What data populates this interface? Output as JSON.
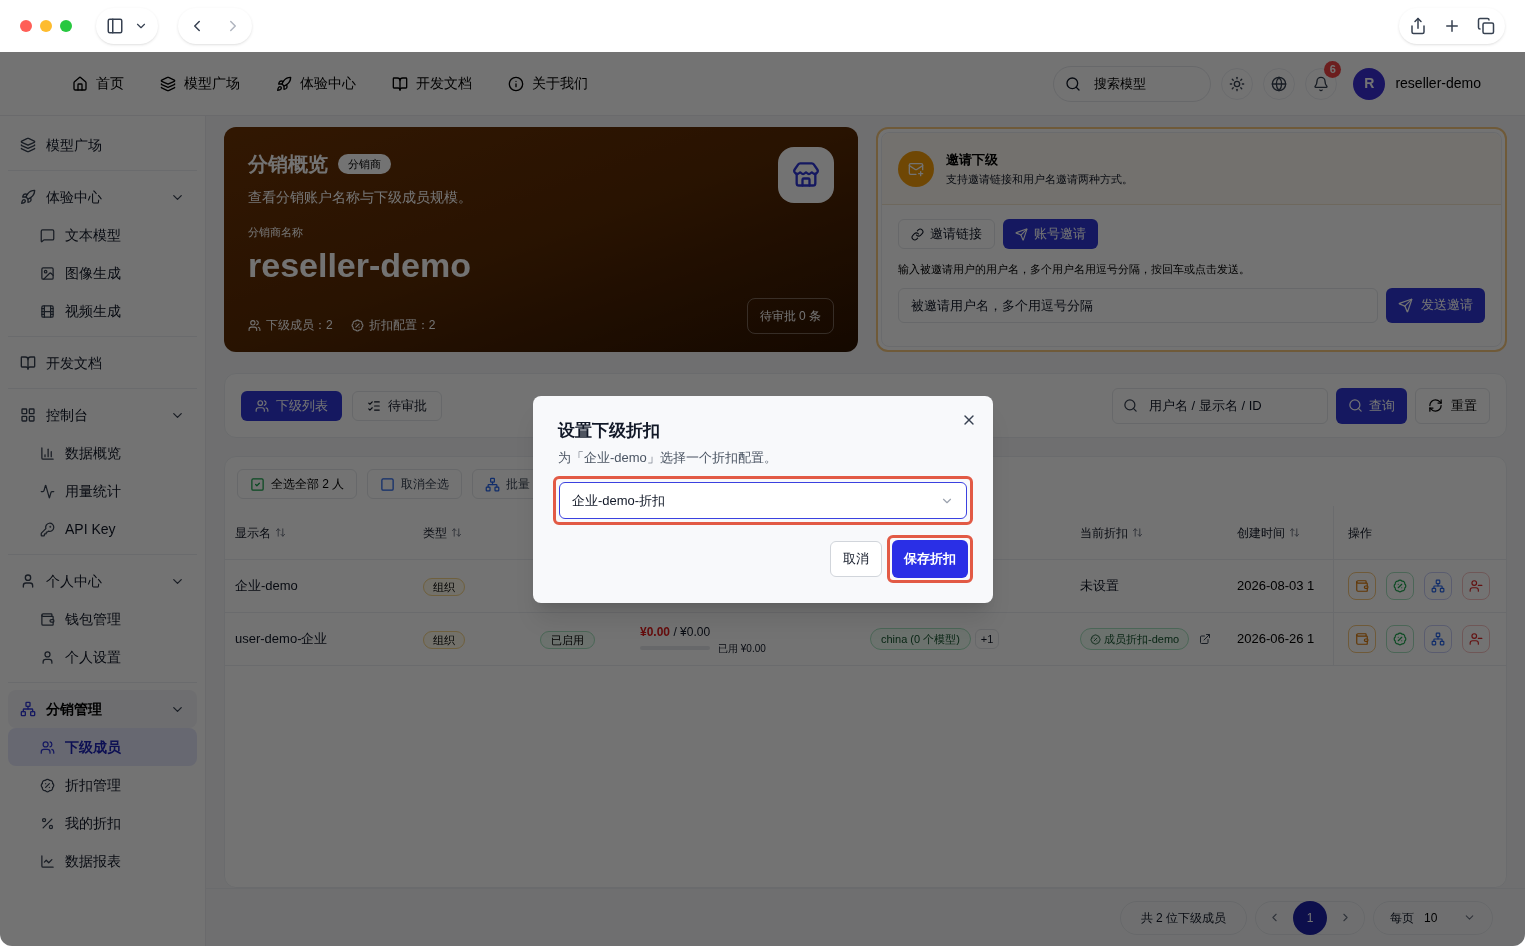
{
  "nav": {
    "items": [
      {
        "label": "首页"
      },
      {
        "label": "模型广场"
      },
      {
        "label": "体验中心"
      },
      {
        "label": "开发文档"
      },
      {
        "label": "关于我们"
      }
    ],
    "search": {
      "placeholder": "搜索模型"
    },
    "notifications": "6",
    "user": {
      "initial": "R",
      "name": "reseller-demo"
    }
  },
  "sidebar": {
    "sections": [
      {
        "label": "模型广场",
        "active": false
      },
      {
        "label": "体验中心",
        "active": false,
        "expanded": true,
        "children": [
          {
            "label": "文本模型",
            "selected": false
          },
          {
            "label": "图像生成",
            "selected": false
          },
          {
            "label": "视频生成",
            "selected": false
          }
        ]
      },
      {
        "label": "开发文档",
        "active": false
      },
      {
        "label": "控制台",
        "active": false,
        "expanded": true,
        "children": [
          {
            "label": "数据概览",
            "selected": false
          },
          {
            "label": "用量统计",
            "selected": false
          },
          {
            "label": "API Key",
            "selected": false
          }
        ]
      },
      {
        "label": "个人中心",
        "active": false,
        "expanded": true,
        "children": [
          {
            "label": "钱包管理",
            "selected": false
          },
          {
            "label": "个人设置",
            "selected": false
          }
        ]
      },
      {
        "label": "分销管理",
        "active": true,
        "expanded": true,
        "children": [
          {
            "label": "下级成员",
            "selected": true
          },
          {
            "label": "折扣管理",
            "selected": false
          },
          {
            "label": "我的折扣",
            "selected": false
          },
          {
            "label": "数据报表",
            "selected": false
          }
        ]
      }
    ]
  },
  "hero": {
    "title": "分销概览",
    "badge": "分销商",
    "subtitle": "查看分销账户名称与下级成员规模。",
    "name_label": "分销商名称",
    "name": "reseller-demo",
    "stats": [
      "下级成员：2",
      "折扣配置：2"
    ],
    "pending": "待审批 0 条"
  },
  "invite": {
    "title": "邀请下级",
    "subtitle": "支持邀请链接和用户名邀请两种方式。",
    "tabs": [
      {
        "label": "邀请链接",
        "selected": false
      },
      {
        "label": "账号邀请",
        "selected": true
      }
    ],
    "hint": "输入被邀请用户的用户名，多个用户名用逗号分隔，按回车或点击发送。",
    "input": {
      "placeholder": "被邀请用户名，多个用逗号分隔"
    },
    "send": "发送邀请"
  },
  "list_tabs": [
    {
      "label": "下级列表",
      "selected": true
    },
    {
      "label": "待审批",
      "selected": false
    }
  ],
  "filter": {
    "placeholder": "用户名 / 显示名 / ID",
    "query": "查询",
    "reset": "重置"
  },
  "bulk": [
    {
      "label": "全选全部 2 人",
      "kind": "select-all"
    },
    {
      "label": "取消全选",
      "kind": "deselect"
    },
    {
      "label": "批量",
      "kind": "batch"
    }
  ],
  "table": {
    "columns": [
      {
        "label": "显示名",
        "sortable": true
      },
      {
        "label": "类型",
        "sortable": true
      },
      {
        "label": "当前折扣",
        "sortable": true
      },
      {
        "label": "创建时间",
        "sortable": true
      },
      {
        "label": "操作",
        "sortable": false
      }
    ],
    "rows": [
      {
        "name": "企业-demo",
        "type": "组织",
        "discount": {
          "label": "未设置",
          "kind": "plain"
        },
        "created": "2026-08-03 1"
      },
      {
        "name": "user-demo-企业",
        "type": "组织",
        "status": "已启用",
        "balance": "¥0.00",
        "quota": "/ ¥0.00",
        "used": "已用 ¥0.00",
        "group": "china (0 个模型)",
        "group_more": "+1",
        "discount": {
          "label": "成员折扣-demo",
          "kind": "tag"
        },
        "created": "2026-06-26 1"
      }
    ]
  },
  "pagination": {
    "total": "共 2 位下级成员",
    "pages": [
      {
        "label": "1",
        "selected": true
      }
    ],
    "per_page_label": "每页",
    "per_page": "10"
  },
  "dialog": {
    "title": "设置下级折扣",
    "description": "为「企业-demo」选择一个折扣配置。",
    "select": {
      "value": "企业-demo-折扣",
      "highlighted": true
    },
    "cancel": "取消",
    "save": {
      "label": "保存折扣",
      "highlighted": true
    }
  }
}
